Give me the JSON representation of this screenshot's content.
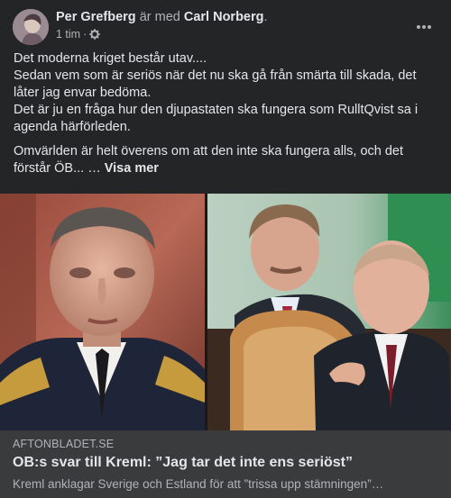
{
  "post": {
    "author": "Per Grefberg",
    "with_text": "är med",
    "tagged": "Carl Norberg",
    "period": ".",
    "time": "1 tim",
    "separator": "·",
    "audience_icon": "gear-icon",
    "more_icon": "more-options-icon",
    "paragraphs": [
      "Det moderna kriget består utav....",
      "Sedan vem som är seriös när det nu ska gå från smärta till skada, det låter jag envar bedöma.",
      "Det är ju en fråga hur den djupastaten ska fungera som RulltQvist sa i agenda härförleden."
    ],
    "last_paragraph": "Omvärlden är helt överens om att den inte ska fungera alls, och det förstår ÖB...",
    "ellipsis": " … ",
    "see_more": "Visa mer"
  },
  "link": {
    "domain": "AFTONBLADET.SE",
    "title": "OB:s svar till Kreml: ”Jag tar det inte ens seriöst”",
    "description": "Kreml anklagar Sverige och Estland för att ”trissa upp stämningen”…"
  },
  "colors": {
    "background": "#242526",
    "card": "#3a3b3c",
    "primary_text": "#e4e6eb",
    "secondary_text": "#b0b3b8"
  }
}
